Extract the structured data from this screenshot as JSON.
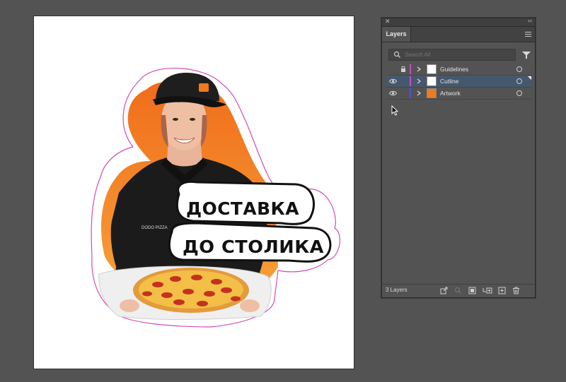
{
  "artboard": {
    "banner_line1": "ДОСТАВКА",
    "banner_line2": "ДО СТОЛИКА",
    "uniform_logo": "DODO PIZZA",
    "colors": {
      "orange": "#f07a1e",
      "cutline": "#d24bb5",
      "shirt": "#1b1b1b",
      "pizza": "#f2b33a",
      "pepperoni": "#c4321f"
    }
  },
  "layers_panel": {
    "tab_label": "Layers",
    "search_placeholder": "Search All",
    "layers": [
      {
        "name": "Guidelines",
        "visible": false,
        "locked": true,
        "color": "#c84cc9",
        "selected": false
      },
      {
        "name": "Cutline",
        "visible": true,
        "locked": false,
        "color": "#c84cc9",
        "selected": true
      },
      {
        "name": "Artwork",
        "visible": true,
        "locked": false,
        "color": "#4f4fe0",
        "selected": false
      }
    ],
    "footer_count": "3 Layers",
    "icons": [
      "close-icon",
      "collapse-icon",
      "panel-menu-icon",
      "search-icon",
      "filter-icon",
      "eye-icon",
      "lock-icon",
      "chevron-right-icon",
      "export-icon",
      "locate-object-icon",
      "clipping-mask-icon",
      "new-sublayer-icon",
      "new-layer-icon",
      "delete-icon"
    ]
  }
}
